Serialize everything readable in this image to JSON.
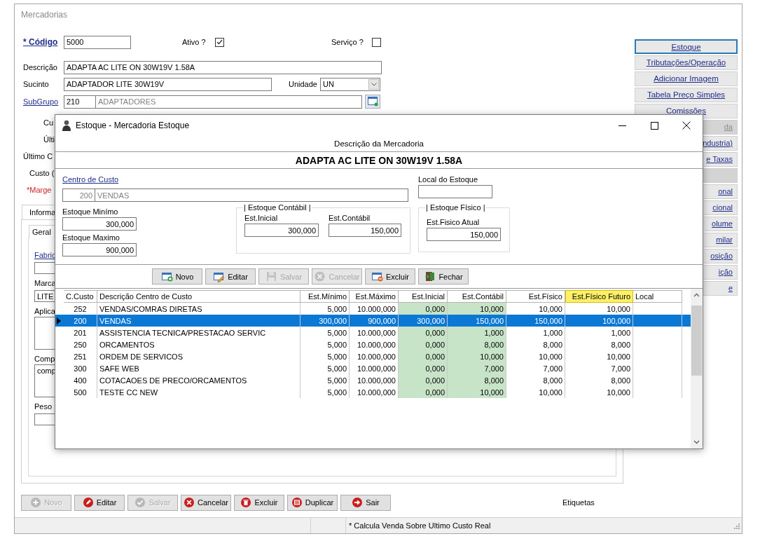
{
  "window": {
    "title": "Mercadorias"
  },
  "form": {
    "codigo_label": "* Código",
    "codigo": "5000",
    "ativo_label": "Ativo ?",
    "ativo_checked": true,
    "servico_label": "Serviço ?",
    "servico_checked": false,
    "descricao_label": "Descrição",
    "descricao": "ADAPTA AC LITE ON 30W19V 1.58A",
    "sucinto_label": "Sucinto",
    "sucinto": "ADAPTADOR LITE 30W19V",
    "unidade_label": "Unidade",
    "unidade": "UN",
    "subgrupo_label": "SubGrupo",
    "subgrupo_code": "210",
    "subgrupo_name": "ADAPTADORES"
  },
  "cost_labels": [
    {
      "text": "Cu",
      "kind": "label"
    },
    {
      "text": "Últi",
      "kind": "label"
    },
    {
      "text": "Último C",
      "kind": "label"
    },
    {
      "text": "Custo (",
      "kind": "label"
    },
    {
      "text": "*Marge",
      "kind": "required"
    }
  ],
  "tabs": [
    {
      "label": "Informa",
      "selected": true
    }
  ],
  "subtabs": [
    {
      "label": "Geral",
      "selected": true
    }
  ],
  "fields": [
    {
      "label": "Fabric",
      "kind": "link"
    },
    {
      "label": "Marca",
      "kind": "text",
      "value": "LITE"
    },
    {
      "label": "Aplica",
      "kind": "memo"
    },
    {
      "label": "Comp",
      "kind": "memo",
      "value": "comp"
    },
    {
      "label": "Peso",
      "kind": "text"
    }
  ],
  "side_buttons": [
    {
      "label": "Estoque",
      "focused": true,
      "disabled": false
    },
    {
      "label": "Tributações/Operação",
      "focused": false,
      "disabled": false
    },
    {
      "label": "Adicionar Imagem",
      "focused": false,
      "disabled": false
    },
    {
      "label": "Tabela Preço Simples",
      "focused": false,
      "disabled": false
    },
    {
      "label": "Comissões",
      "focused": false,
      "disabled": false
    }
  ],
  "side_buttons_covered": [
    {
      "label": "da",
      "disabled": true
    },
    {
      "label": "ndustria)",
      "disabled": false
    },
    {
      "label": "e Taxas",
      "disabled": false
    },
    {
      "disabled": true
    },
    {
      "label": "onal",
      "disabled": false
    },
    {
      "label": "cional",
      "disabled": false
    },
    {
      "label": "olume",
      "disabled": false
    },
    {
      "label": "milar",
      "disabled": false
    },
    {
      "label": "osição",
      "disabled": false
    },
    {
      "label": "ição",
      "disabled": false
    },
    {
      "label": "e",
      "disabled": false
    }
  ],
  "bottom_buttons": [
    {
      "label": "Novo",
      "disabled": true
    },
    {
      "label": "Editar",
      "disabled": false
    },
    {
      "label": "Salvar",
      "disabled": true
    },
    {
      "label": "Cancelar",
      "disabled": false
    },
    {
      "label": "Excluir",
      "disabled": false
    },
    {
      "label": "Duplicar",
      "disabled": false
    },
    {
      "label": "Sair",
      "disabled": false
    }
  ],
  "etiquetas": "Etiquetas",
  "status_bar": {
    "text": "* Calcula Venda Sobre Ultimo Custo  Real"
  },
  "dialog": {
    "title": "Estoque - Mercadoria Estoque",
    "description_label": "Descrição da Mercadoria",
    "description": "ADAPTA AC LITE ON 30W19V 1.58A",
    "cost_center_label": "Centro de Custo",
    "cost_center_code": "200",
    "cost_center_name": "VENDAS",
    "location_label": "Local do Estoque",
    "min_label": "Estoque Minímo",
    "min": "300,000",
    "max_label": "Estoque Maximo",
    "max": "900,000",
    "accounting_group": "| Estoque Contábil |",
    "initial_label": "Est.Inicial",
    "initial": "300,000",
    "accounting_label": "Est.Contábil",
    "accounting": "150,000",
    "physical_group": "| Estoque Físico |",
    "physical_label": "Est.Fisico Atual",
    "physical": "150,000",
    "toolbar": [
      {
        "label": "Novo",
        "disabled": false
      },
      {
        "label": "Editar",
        "disabled": false
      },
      {
        "label": "Salvar",
        "disabled": true
      },
      {
        "label": "Cancelar",
        "disabled": true
      },
      {
        "label": "Excluir",
        "disabled": false
      },
      {
        "label": "Fechar",
        "disabled": false
      }
    ],
    "table": {
      "columns": [
        {
          "label": "C.Custo",
          "kind": "code"
        },
        {
          "label": "Descrição Centro de Custo",
          "kind": "text"
        },
        {
          "label": "Est.Mínimo",
          "kind": "number"
        },
        {
          "label": "Est.Máximo",
          "kind": "number"
        },
        {
          "label": "Est.Inicial",
          "kind": "number",
          "color": "#c8e4c8"
        },
        {
          "label": "Est.Contábil",
          "kind": "number",
          "color": "#c8e4c8"
        },
        {
          "label": "Est.Físico",
          "kind": "number"
        },
        {
          "label": "Est.Físico Futuro",
          "kind": "number",
          "color": "#fff06a",
          "header_highlight": true
        },
        {
          "label": "Local",
          "kind": "text"
        }
      ],
      "rows": [
        {
          "cells": [
            "252",
            "VENDAS/COMRAS DIRETAS",
            "5,000",
            "10.000,000",
            "0,000",
            "10,000",
            "10,000",
            "10,000"
          ],
          "selected": false
        },
        {
          "cells": [
            "200",
            "VENDAS",
            "300,000",
            "900,000",
            "300,000",
            "150,000",
            "150,000",
            "100,000"
          ],
          "selected": true
        },
        {
          "cells": [
            "201",
            "ASSISTENCIA TECNICA/PRESTACAO SERVIC",
            "5,000",
            "10.000,000",
            "0,000",
            "1,000",
            "1,000",
            "1,000"
          ],
          "selected": false
        },
        {
          "cells": [
            "250",
            "ORCAMENTOS",
            "5,000",
            "10.000,000",
            "0,000",
            "8,000",
            "8,000",
            "8,000"
          ],
          "selected": false
        },
        {
          "cells": [
            "251",
            "ORDEM DE SERVICOS",
            "5,000",
            "10.000,000",
            "0,000",
            "10,000",
            "10,000",
            "10,000"
          ],
          "selected": false
        },
        {
          "cells": [
            "300",
            "SAFE WEB",
            "5,000",
            "10.000,000",
            "0,000",
            "7,000",
            "7,000",
            "7,000"
          ],
          "selected": false
        },
        {
          "cells": [
            "400",
            "COTACAOES DE PRECO/ORCAMENTOS",
            "5,000",
            "10.000,000",
            "0,000",
            "8,000",
            "8,000",
            "8,000"
          ],
          "selected": false
        },
        {
          "cells": [
            "500",
            "TESTE CC NEW",
            "5,000",
            "10.000,000",
            "0,000",
            "10,000",
            "10,000",
            "10,000"
          ],
          "selected": false
        }
      ]
    }
  }
}
